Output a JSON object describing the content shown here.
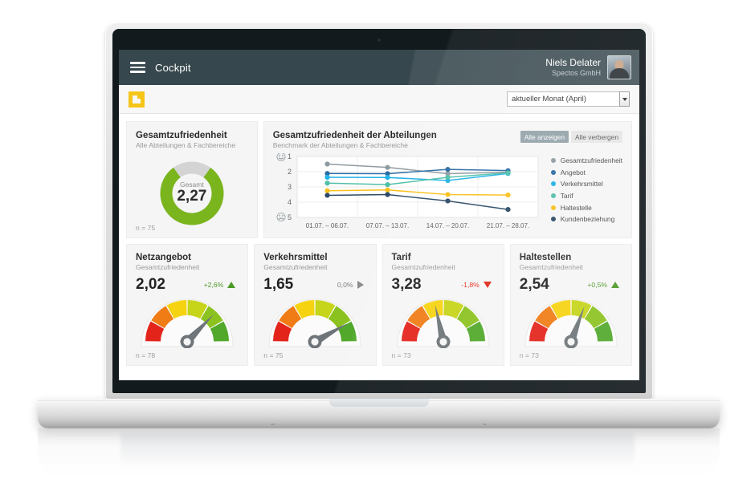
{
  "app": {
    "menu_icon": "hamburger-menu-icon",
    "title": "Cockpit",
    "user_name": "Niels Delater",
    "user_org": "Spectos GmbH",
    "avatar_icon": "user-avatar"
  },
  "toolbar": {
    "brand_icon": "spectos-logo-mark",
    "period_value": "aktueller Monat (April)",
    "period_placeholder": "aktueller Monat (April)",
    "dropdown_icon": "chevron-down-icon"
  },
  "overall": {
    "title": "Gesamtzufriedenheit",
    "subtitle": "Alle Abteilungen & Fachbereiche",
    "donut_label": "Gesamt",
    "donut_value": "2,27",
    "n_label": "n = 75",
    "donut_pct": 80,
    "donut_color": "#7ab51d",
    "donut_track": "#d4d4d4"
  },
  "benchmark": {
    "title": "Gesamtzufriedenheit der Abteilungen",
    "subtitle": "Benchmark der Abteilungen & Fachbereiche",
    "show_all_label": "Alle anzeigen",
    "hide_all_label": "Alle verbergen",
    "axis_top_icon": "smiley-happy-icon",
    "axis_bottom_icon": "smiley-sad-icon"
  },
  "chart_data": {
    "type": "line",
    "title": "Gesamtzufriedenheit der Abteilungen",
    "subtitle": "Benchmark der Abteilungen & Fachbereiche",
    "xlabel": "",
    "ylabel": "",
    "categories": [
      "01.07. – 06.07.",
      "07.07. – 13.07.",
      "14.07. – 20.07.",
      "21.07. – 28.07."
    ],
    "yticks": [
      1,
      2,
      3,
      4,
      5
    ],
    "ylim": [
      1,
      5
    ],
    "y_inverted": true,
    "grid": true,
    "legend_position": "right",
    "series": [
      {
        "name": "Gesamtzufriedenheit",
        "color": "#8f9ba1",
        "values": [
          1.5,
          1.72,
          2.13,
          2.03
        ]
      },
      {
        "name": "Angebot",
        "color": "#2b6ca3",
        "values": [
          2.12,
          2.13,
          1.85,
          1.93
        ]
      },
      {
        "name": "Verkehrsmittel",
        "color": "#20b2e8",
        "values": [
          2.37,
          2.38,
          2.58,
          2.12
        ]
      },
      {
        "name": "Tarif",
        "color": "#4fc0a8",
        "values": [
          2.75,
          2.85,
          2.37,
          2.08
        ]
      },
      {
        "name": "Haltestelle",
        "color": "#fbc01b",
        "values": [
          3.25,
          3.2,
          3.5,
          3.53
        ]
      },
      {
        "name": "Kundenbeziehung",
        "color": "#2c4a67",
        "values": [
          3.55,
          3.5,
          3.92,
          4.48
        ]
      }
    ]
  },
  "gauges": [
    {
      "title": "Netzangebot",
      "subtitle": "Gesamtzufriedenheit",
      "value": "2,02",
      "delta": "+2,6%",
      "delta_direction": "up",
      "delta_color": "#4e9a28",
      "n_label": "n = 78",
      "needle_value": 2.02
    },
    {
      "title": "Verkehrsmittel",
      "subtitle": "Gesamtzufriedenheit",
      "value": "1,65",
      "delta": "0,0%",
      "delta_direction": "flat",
      "delta_color": "#7d7d7d",
      "n_label": "n = 75",
      "needle_value": 1.65
    },
    {
      "title": "Tarif",
      "subtitle": "Gesamtzufriedenheit",
      "value": "3,28",
      "delta": "-1,8%",
      "delta_direction": "down",
      "delta_color": "#e02b1d",
      "n_label": "n = 73",
      "needle_value": 3.28
    },
    {
      "title": "Haltestellen",
      "subtitle": "Gesamtzufriedenheit",
      "value": "2,54",
      "delta": "+0,5%",
      "delta_direction": "up",
      "delta_color": "#4e9a28",
      "n_label": "n = 73",
      "needle_value": 2.54
    }
  ],
  "gauge_palette": [
    "#e3241b",
    "#f07c16",
    "#f5d311",
    "#c6d41a",
    "#8cc220",
    "#51a82b"
  ]
}
